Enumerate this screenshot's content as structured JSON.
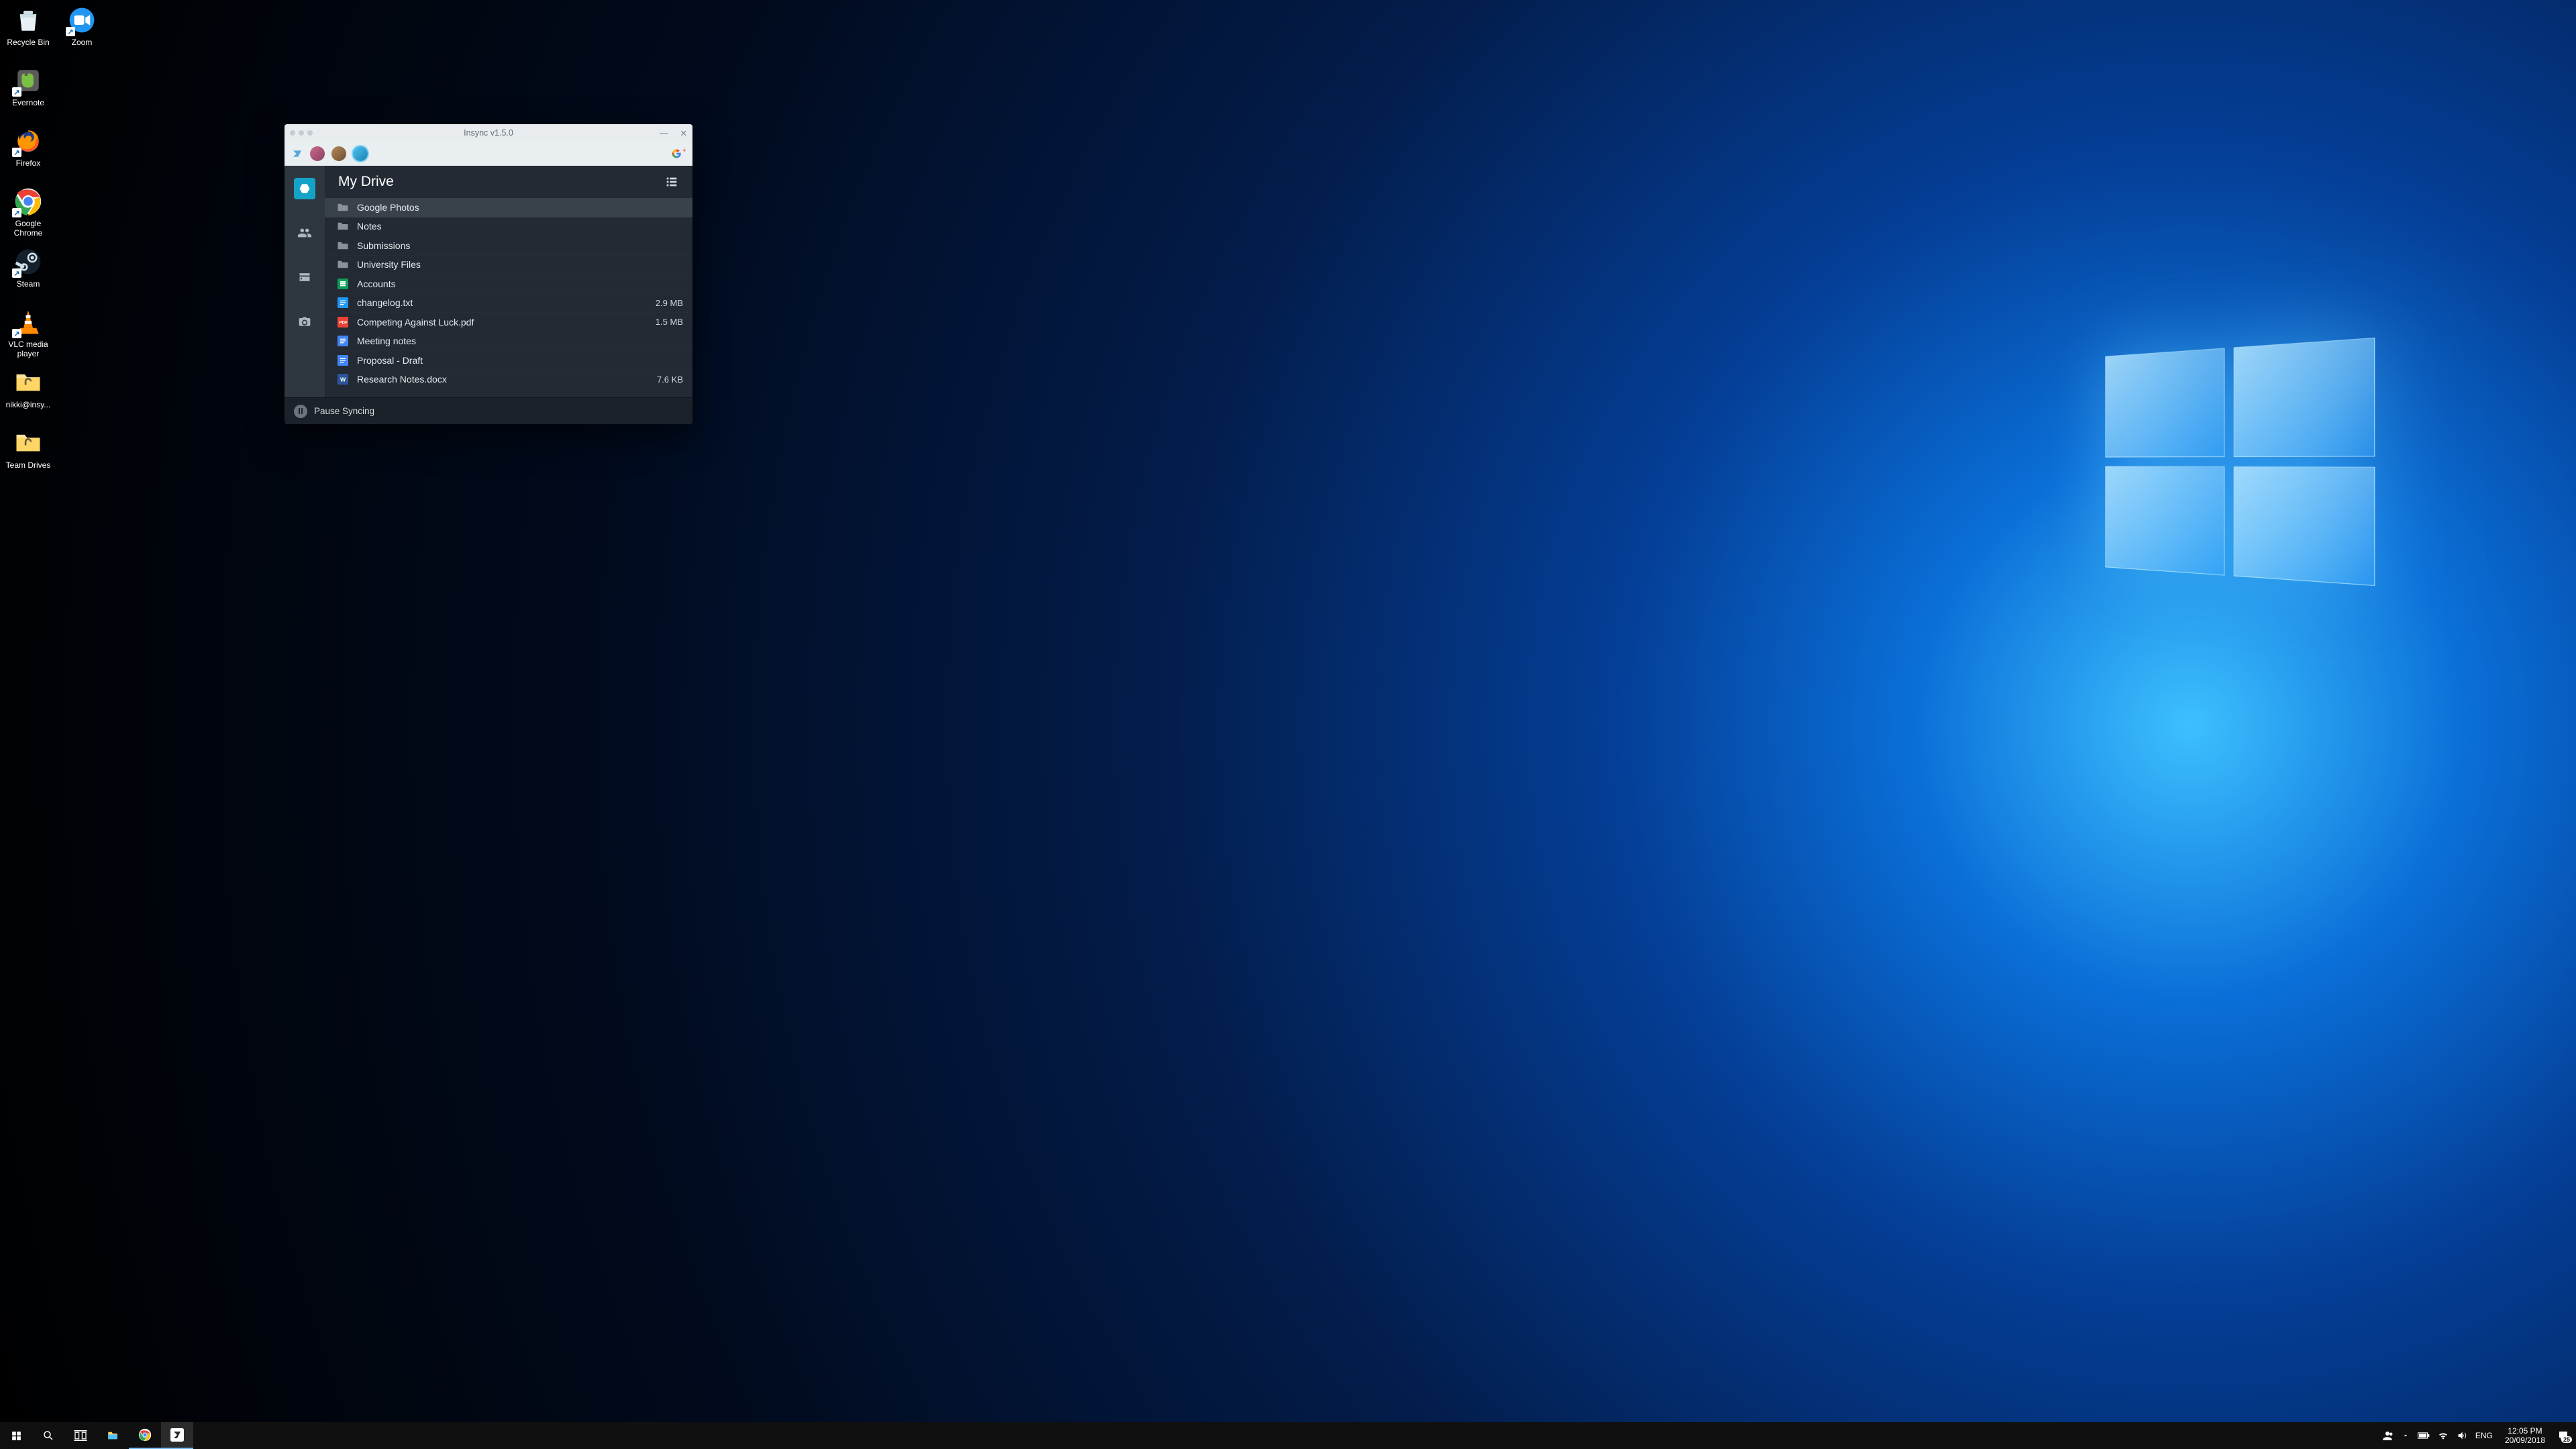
{
  "desktop": {
    "icons_col1": [
      {
        "label": "Recycle Bin",
        "kind": "recycle"
      },
      {
        "label": "Evernote",
        "kind": "evernote"
      },
      {
        "label": "Firefox",
        "kind": "firefox"
      },
      {
        "label": "Google Chrome",
        "kind": "chrome"
      },
      {
        "label": "Steam",
        "kind": "steam"
      },
      {
        "label": "VLC media player",
        "kind": "vlc"
      },
      {
        "label": "nikki@insy...",
        "kind": "folder"
      },
      {
        "label": "Team Drives",
        "kind": "folder"
      }
    ],
    "icons_col2": [
      {
        "label": "Zoom",
        "kind": "zoom"
      }
    ]
  },
  "taskbar": {
    "lang": "ENG",
    "time": "12:05 PM",
    "date": "20/09/2018",
    "notification_count": "25"
  },
  "window": {
    "title": "Insync v1.5.0",
    "heading": "My Drive",
    "pause_label": "Pause Syncing",
    "files": [
      {
        "name": "Google Photos",
        "type": "folder",
        "size": "",
        "hover": true
      },
      {
        "name": "Notes",
        "type": "folder",
        "size": ""
      },
      {
        "name": "Submissions",
        "type": "folder",
        "size": ""
      },
      {
        "name": "University Files",
        "type": "folder",
        "size": ""
      },
      {
        "name": "Accounts",
        "type": "gsheet",
        "size": ""
      },
      {
        "name": "changelog.txt",
        "type": "txt",
        "size": "2.9 MB"
      },
      {
        "name": "Competing Against Luck.pdf",
        "type": "pdf",
        "size": "1.5 MB"
      },
      {
        "name": "Meeting notes",
        "type": "gdoc",
        "size": ""
      },
      {
        "name": "Proposal - Draft",
        "type": "gdoc",
        "size": ""
      },
      {
        "name": "Research Notes.docx",
        "type": "word",
        "size": "7.6 KB"
      }
    ]
  }
}
